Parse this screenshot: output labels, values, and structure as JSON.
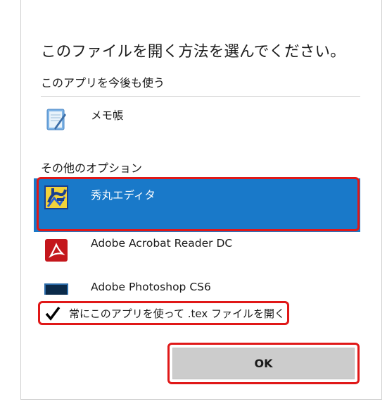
{
  "dialog": {
    "title": "このファイルを開く方法を選んでください。",
    "keep_section_label": "このアプリを今後も使う",
    "other_section_label": "その他のオプション",
    "apps": [
      {
        "name": "メモ帳",
        "icon": "notepad-icon"
      },
      {
        "name": "秀丸エディタ",
        "icon": "hidemaru-icon",
        "selected": true
      },
      {
        "name": "Adobe Acrobat Reader DC",
        "icon": "acrobat-icon"
      },
      {
        "name": "Adobe Photoshop CS6",
        "icon": "photoshop-icon"
      }
    ],
    "always_use": {
      "label": "常にこのアプリを使って .tex ファイルを開く",
      "checked": true
    },
    "ok_label": "OK",
    "colors": {
      "selected": "#1979c9",
      "highlight_border": "#e01818",
      "button": "#cccccc"
    }
  }
}
